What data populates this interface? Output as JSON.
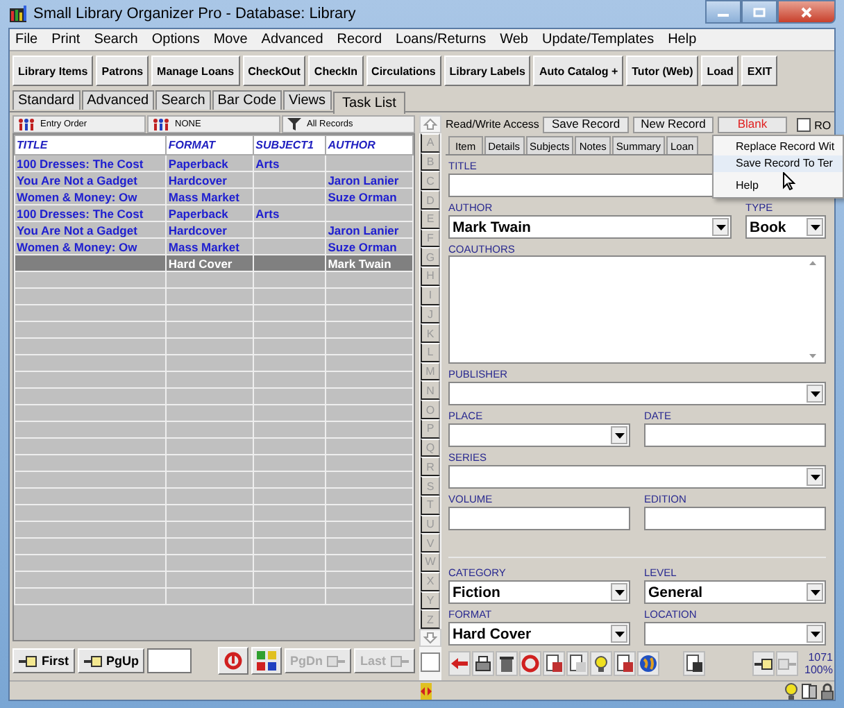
{
  "window": {
    "title": "Small Library Organizer Pro - Database: Library"
  },
  "menu": [
    "File",
    "Print",
    "Search",
    "Options",
    "Move",
    "Advanced",
    "Record",
    "Loans/Returns",
    "Web",
    "Update/Templates",
    "Help"
  ],
  "toolbar": [
    "Library Items",
    "Patrons",
    "Manage Loans",
    "CheckOut",
    "CheckIn",
    "Circulations",
    "Library Labels",
    "Auto Catalog +",
    "Tutor (Web)",
    "Load",
    "EXIT"
  ],
  "view_tabs": [
    {
      "label": "Standard",
      "selected": false
    },
    {
      "label": "Advanced",
      "selected": false
    },
    {
      "label": "Search",
      "selected": false
    },
    {
      "label": "Bar Code",
      "selected": false
    },
    {
      "label": "Views",
      "selected": false
    },
    {
      "label": "Task List",
      "selected": true
    }
  ],
  "sort_bar": [
    {
      "kind": "sort",
      "label": "Entry Order"
    },
    {
      "kind": "sort",
      "label": "NONE"
    },
    {
      "kind": "filter",
      "label": "All Records"
    }
  ],
  "table": {
    "columns": [
      "TITLE",
      "FORMAT",
      "SUBJECT1",
      "AUTHOR"
    ],
    "rows": [
      {
        "cells": [
          "100 Dresses: The Cost",
          "Paperback",
          "Arts",
          ""
        ],
        "selected": false
      },
      {
        "cells": [
          "You Are Not a Gadget",
          "Hardcover",
          "",
          "Jaron Lanier"
        ],
        "selected": false
      },
      {
        "cells": [
          "Women & Money: Ow",
          "Mass Market",
          "",
          "Suze Orman"
        ],
        "selected": false
      },
      {
        "cells": [
          "100 Dresses: The Cost",
          "Paperback",
          "Arts",
          ""
        ],
        "selected": false
      },
      {
        "cells": [
          "You Are Not a Gadget",
          "Hardcover",
          "",
          "Jaron Lanier"
        ],
        "selected": false
      },
      {
        "cells": [
          "Women & Money: Ow",
          "Mass Market",
          "",
          "Suze Orman"
        ],
        "selected": false
      },
      {
        "cells": [
          "",
          "Hard Cover",
          "",
          "Mark Twain"
        ],
        "selected": true
      }
    ]
  },
  "nav": [
    {
      "kind": "back",
      "label": "First",
      "disabled": false
    },
    {
      "kind": "back",
      "label": "PgUp",
      "disabled": false
    },
    {
      "kind": "field"
    },
    {
      "kind": "refresh"
    },
    {
      "kind": "grid"
    },
    {
      "kind": "forward",
      "label": "PgDn",
      "disabled": true
    },
    {
      "kind": "forward",
      "label": "Last",
      "disabled": true
    }
  ],
  "letter_checkbox": {
    "checked": false
  },
  "letters": [
    "A",
    "B",
    "C",
    "D",
    "E",
    "F",
    "G",
    "H",
    "I",
    "J",
    "K",
    "L",
    "M",
    "N",
    "O",
    "P",
    "Q",
    "R",
    "S",
    "T",
    "U",
    "V",
    "W",
    "X",
    "Y",
    "Z"
  ],
  "record_bar": {
    "access": "Read/Write Access",
    "buttons": [
      {
        "label": "Save Record",
        "kind": "normal"
      },
      {
        "label": "New Record",
        "kind": "normal"
      },
      {
        "label": "Blank",
        "kind": "warning"
      }
    ],
    "ro": {
      "label": "RO",
      "checked": false
    }
  },
  "record_tabs": [
    {
      "label": "Item",
      "selected": true
    },
    {
      "label": "Details",
      "selected": false
    },
    {
      "label": "Subjects",
      "selected": false
    },
    {
      "label": "Notes",
      "selected": false
    },
    {
      "label": "Summary",
      "selected": false
    },
    {
      "label": "Loan",
      "selected": false
    }
  ],
  "form": {
    "sections": [
      {
        "rows": [
          {
            "kind": "single",
            "fields": [
              {
                "label": "TITLE",
                "kind": "input"
              }
            ]
          },
          {
            "kind": "main-side",
            "fields": [
              {
                "label": "AUTHOR",
                "kind": "combo",
                "value": "Mark Twain"
              },
              {
                "label": "TYPE",
                "kind": "combo",
                "value": "Book"
              }
            ]
          },
          {
            "kind": "single",
            "fields": [
              {
                "label": "COAUTHORS",
                "kind": "textarea"
              }
            ]
          },
          {
            "kind": "single",
            "fields": [
              {
                "label": "PUBLISHER",
                "kind": "combo"
              }
            ]
          },
          {
            "kind": "pair",
            "fields": [
              {
                "label": "PLACE",
                "kind": "combo"
              },
              {
                "label": "DATE",
                "kind": "input"
              }
            ]
          },
          {
            "kind": "single",
            "fields": [
              {
                "label": "SERIES",
                "kind": "combo"
              }
            ]
          },
          {
            "kind": "pair",
            "fields": [
              {
                "label": "VOLUME",
                "kind": "input"
              },
              {
                "label": "EDITION",
                "kind": "input"
              }
            ]
          }
        ]
      },
      {
        "rows": [
          {
            "kind": "pair",
            "fields": [
              {
                "label": "CATEGORY",
                "kind": "combo",
                "value": "Fiction"
              },
              {
                "label": "LEVEL",
                "kind": "combo",
                "value": "General"
              }
            ]
          },
          {
            "kind": "pair",
            "fields": [
              {
                "label": "FORMAT",
                "kind": "combo",
                "value": "Hard Cover"
              },
              {
                "label": "LOCATION",
                "kind": "combo"
              }
            ]
          }
        ]
      }
    ]
  },
  "context_menu": [
    {
      "label": "Replace Record Wit",
      "selected": false
    },
    {
      "label": "Save Record To Ter",
      "selected": true
    },
    {
      "label": "Help",
      "selected": false
    }
  ],
  "stats": [
    "1071",
    "100%"
  ]
}
